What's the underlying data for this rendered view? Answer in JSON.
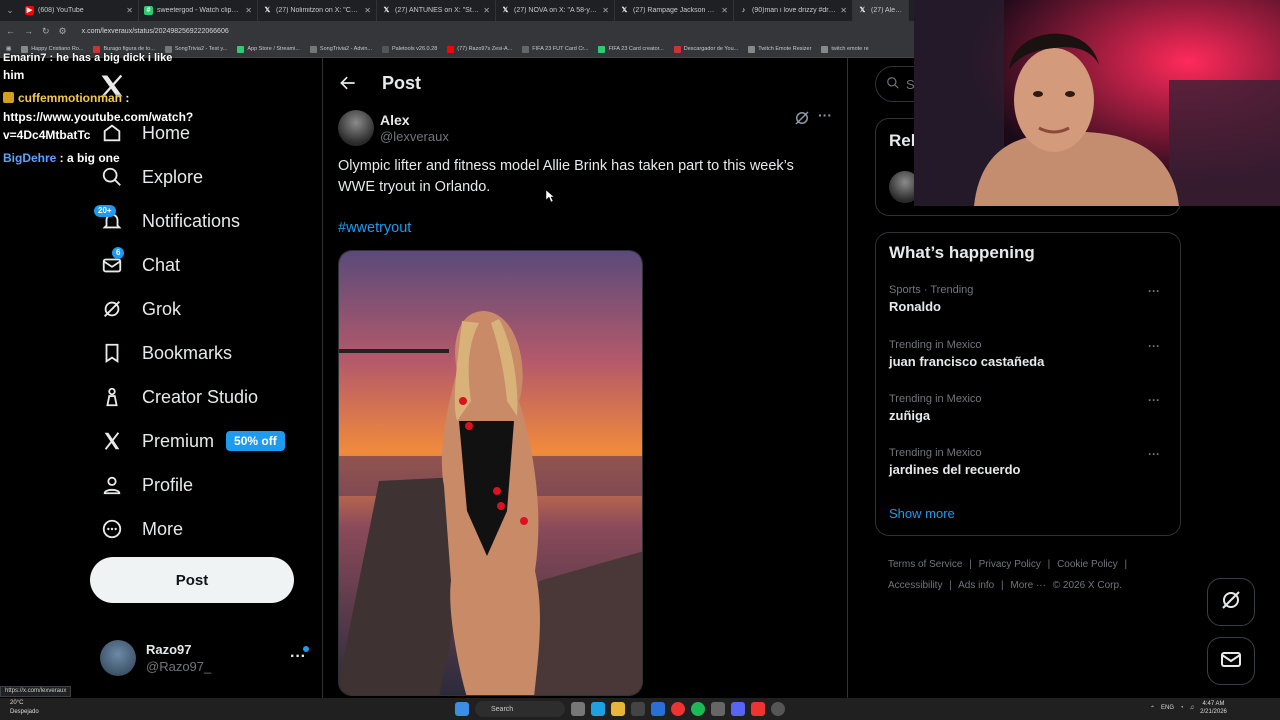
{
  "browser": {
    "tabs": [
      {
        "label": "(608) YouTube",
        "color": "#ff0000"
      },
      {
        "label": "sweetergod - Watch clips on X",
        "color": "#2ecc71"
      },
      {
        "label": "(27) Nolimitzon on X: \"CEO of T",
        "color": "#444"
      },
      {
        "label": "(27) ANTUNES on X: \"Streame",
        "color": "#444"
      },
      {
        "label": "(27) NOVA on X: \"A 58-year-old",
        "color": "#444"
      },
      {
        "label": "(27) Rampage Jackson on X: \"A",
        "color": "#444"
      },
      {
        "label": "(90)man i love drizzy #drake #",
        "color": "#111"
      },
      {
        "label": "(27) Alex on X: \"O",
        "color": "#444"
      }
    ],
    "url": "x.com/lexveraux/status/2024982569222066606",
    "bookmarks": [
      "Happy Cristiano Ro...",
      "Burago figura de to...",
      "SongTrivia2 - Test y...",
      "App Store / Streami...",
      "SongTrivia2 - Advin...",
      "Paletools v26.0.28",
      "(77) Razo97s Zesi-A...",
      "FIFA 23 FUT Card Cr...",
      "FIFA 23 Card creator...",
      "Descargador de You...",
      "Twitch Emote Resizer",
      "twitch emote re"
    ],
    "status_url": "https://x.com/lexveraux"
  },
  "chat": [
    {
      "user": "",
      "text": "Emarin7 : he has a big dick i like"
    },
    {
      "user": "",
      "text": "him"
    },
    {
      "user": "cuffemmotionman",
      "text": " :"
    },
    {
      "user": "",
      "text": "https://www.youtube.com/watch?"
    },
    {
      "user": "",
      "text": "v=4Dc4MtbatTc"
    },
    {
      "user": "BigDehre",
      "text": " : a big one"
    }
  ],
  "sidebar": {
    "items": [
      {
        "label": "Home",
        "icon": "home-icon"
      },
      {
        "label": "Explore",
        "icon": "search-icon"
      },
      {
        "label": "Notifications",
        "icon": "bell-icon",
        "badge": "20+"
      },
      {
        "label": "Chat",
        "icon": "mail-icon",
        "badge": "6"
      },
      {
        "label": "Grok",
        "icon": "grok-icon"
      },
      {
        "label": "Bookmarks",
        "icon": "bookmark-icon"
      },
      {
        "label": "Creator Studio",
        "icon": "creator-studio-icon"
      },
      {
        "label": "Premium",
        "icon": "x-logo-icon",
        "badge": "50% off"
      },
      {
        "label": "Profile",
        "icon": "person-icon"
      },
      {
        "label": "More",
        "icon": "more-circle-icon"
      }
    ],
    "post_button": "Post",
    "account": {
      "name": "Razo97",
      "handle": "@Razo97_"
    }
  },
  "main": {
    "header_title": "Post",
    "author": {
      "name": "Alex",
      "handle": "@lexveraux"
    },
    "text": "Olympic lifter and fitness model Allie Brink has taken part to this week’s WWE tryout in Orlando.",
    "hashtag": "#wwetryout"
  },
  "right": {
    "search_placeholder": "Se",
    "relevant_title": "Rel",
    "happening_title": "What’s happening",
    "trends": [
      {
        "context": "Sports · Trending",
        "name": "Ronaldo"
      },
      {
        "context": "Trending in Mexico",
        "name": "juan francisco castañeda"
      },
      {
        "context": "Trending in Mexico",
        "name": "zuñiga"
      },
      {
        "context": "Trending in Mexico",
        "name": "jardines del recuerdo"
      }
    ],
    "show_more": "Show more",
    "footer": {
      "line1": [
        "Terms of Service",
        "|",
        "Privacy Policy",
        "|",
        "Cookie Policy",
        "|"
      ],
      "line2": [
        "Accessibility",
        "|",
        "Ads info",
        "|",
        "More ···",
        "© 2026 X Corp."
      ]
    }
  },
  "taskbar": {
    "weather_temp": "20°C",
    "weather_desc": "Despejado",
    "search_label": "Search",
    "lang": "ENG",
    "time": "4:47 AM",
    "date": "2/21/2026"
  },
  "colors": {
    "accent": "#1d9bf0",
    "background": "#000000",
    "text": "#e7e9ea",
    "muted": "#71767b"
  }
}
